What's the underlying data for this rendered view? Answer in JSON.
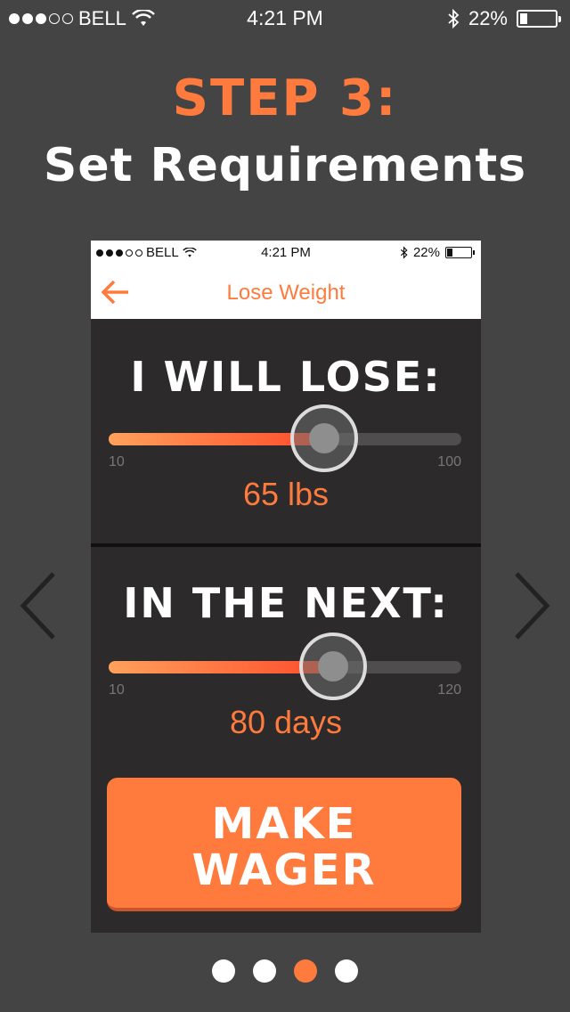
{
  "status_bar": {
    "carrier": "BELL",
    "time": "4:21 PM",
    "battery": "22%",
    "battery_level": 0.22
  },
  "header": {
    "step": "STEP 3:",
    "title": "Set Requirements"
  },
  "phone": {
    "status_bar": {
      "carrier": "BELL",
      "time": "4:21 PM",
      "battery": "22%"
    },
    "nav": {
      "title": "Lose Weight"
    },
    "lose_section": {
      "heading": "I WILL LOSE:",
      "min": "10",
      "max": "100",
      "value_label": "65 lbs",
      "value": 65,
      "min_value": 10,
      "max_value": 100
    },
    "period_section": {
      "heading": "IN THE NEXT:",
      "min": "10",
      "max": "120",
      "value_label": "80 days",
      "value": 80,
      "min_value": 10,
      "max_value": 120
    },
    "wager_button": {
      "line1": "MAKE",
      "line2": "WAGER"
    }
  },
  "pager": {
    "count": 4,
    "active_index": 2
  },
  "colors": {
    "accent": "#FF7A3D",
    "background": "#444444",
    "phone_bg": "#2c2a2a"
  },
  "icons": {
    "prev": "chevron-left-icon",
    "next": "chevron-right-icon",
    "back": "back-arrow-icon"
  }
}
